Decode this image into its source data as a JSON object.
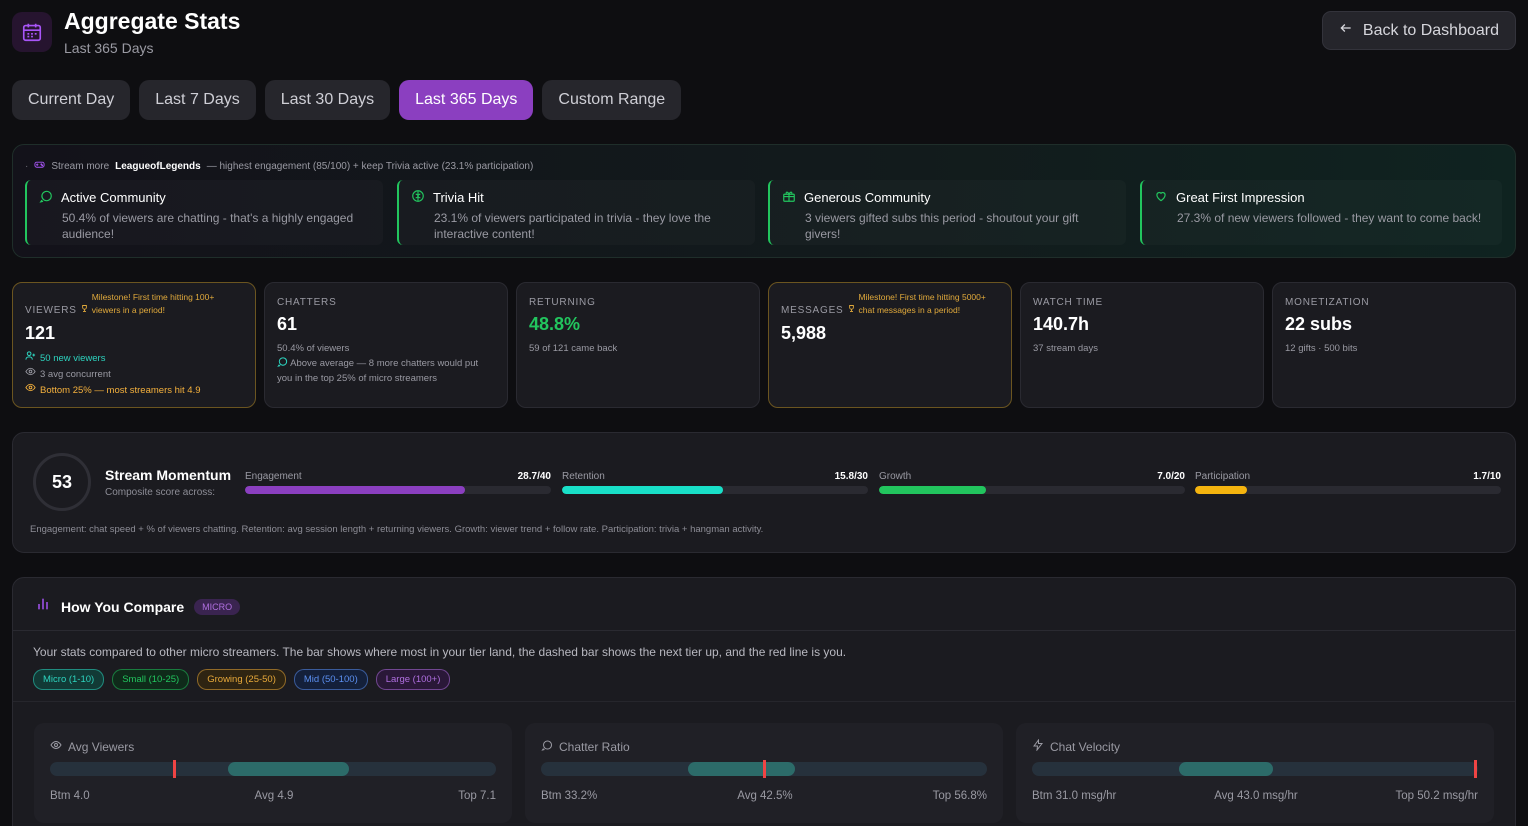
{
  "header": {
    "title": "Aggregate Stats",
    "subtitle": "Last 365 Days",
    "back_label": "Back to Dashboard"
  },
  "tabs": [
    {
      "label": "Current Day",
      "active": false
    },
    {
      "label": "Last 7 Days",
      "active": false
    },
    {
      "label": "Last 30 Days",
      "active": false
    },
    {
      "label": "Last 365 Days",
      "active": true
    },
    {
      "label": "Custom Range",
      "active": false
    }
  ],
  "insights": {
    "tip_prefix": "Stream more",
    "tip_game": "LeagueofLegends",
    "tip_suffix": "— highest engagement (85/100) + keep Trivia active (23.1% participation)",
    "cards": [
      {
        "title": "Active Community",
        "desc": "50.4% of viewers are chatting - that's a highly engaged audience!",
        "icon": "chat-icon"
      },
      {
        "title": "Trivia Hit",
        "desc": "23.1% of viewers participated in trivia - they love the interactive content!",
        "icon": "brain-icon"
      },
      {
        "title": "Generous Community",
        "desc": "3 viewers gifted subs this period - shoutout your gift givers!",
        "icon": "gift-icon"
      },
      {
        "title": "Great First Impression",
        "desc": "27.3% of new viewers followed - they want to come back!",
        "icon": "heart-icon"
      }
    ]
  },
  "stats": {
    "viewers": {
      "label": "VIEWERS",
      "milestone": "Milestone! First time hitting 100+ viewers in a period!",
      "value": "121",
      "new_viewers": "50 new viewers",
      "concurrent": "3 avg concurrent",
      "warning": "Bottom 25% — most streamers hit 4.9"
    },
    "chatters": {
      "label": "CHATTERS",
      "value": "61",
      "sub": "50.4% of viewers",
      "note": "Above average — 8 more chatters would put you in the top 25% of micro streamers"
    },
    "returning": {
      "label": "RETURNING",
      "value": "48.8%",
      "sub": "59 of 121 came back"
    },
    "messages": {
      "label": "MESSAGES",
      "milestone": "Milestone! First time hitting 5000+ chat messages in a period!",
      "value": "5,988"
    },
    "watch_time": {
      "label": "WATCH TIME",
      "value": "140.7h",
      "sub": "37 stream days"
    },
    "monetization": {
      "label": "MONETIZATION",
      "value": "22 subs",
      "sub": "12 gifts · 500 bits"
    }
  },
  "momentum": {
    "score": "53",
    "title": "Stream Momentum",
    "subtitle": "Composite score across:",
    "metrics": [
      {
        "label": "Engagement",
        "value_text": "28.7/40",
        "value": 28.7,
        "max": 40,
        "color": "#8b3fc0"
      },
      {
        "label": "Retention",
        "value_text": "15.8/30",
        "value": 15.8,
        "max": 30,
        "color": "#19e0c8"
      },
      {
        "label": "Growth",
        "value_text": "7.0/20",
        "value": 7.0,
        "max": 20,
        "color": "#22c55e"
      },
      {
        "label": "Participation",
        "value_text": "1.7/10",
        "value": 1.7,
        "max": 10,
        "color": "#f5b40f"
      }
    ],
    "note": "Engagement: chat speed + % of viewers chatting. Retention: avg session length + returning viewers. Growth: viewer trend + follow rate. Participation: trivia + hangman activity."
  },
  "compare": {
    "title": "How You Compare",
    "tier": "MICRO",
    "description": "Your stats compared to other micro streamers. The bar shows where most in your tier land, the dashed bar shows the next tier up, and the red line is you.",
    "chips": [
      {
        "label": "Micro (1-10)",
        "color": "#2dd4bf",
        "bg": "#123a36"
      },
      {
        "label": "Small (10-25)",
        "color": "#22c55e",
        "bg": "#0f2a1a"
      },
      {
        "label": "Growing (25-50)",
        "color": "#e8a93a",
        "bg": "#2e2412"
      },
      {
        "label": "Mid (50-100)",
        "color": "#5b8ff0",
        "bg": "#14203a"
      },
      {
        "label": "Large (100+)",
        "color": "#b06fe0",
        "bg": "#2a1838"
      }
    ],
    "cards": [
      {
        "title": "Avg Viewers",
        "icon": "eye-icon",
        "btm": "Btm 4.0",
        "avg": "Avg 4.9",
        "top": "Top 7.1",
        "band_start": 0.4,
        "band_end": 0.67,
        "you": 0.28
      },
      {
        "title": "Chatter Ratio",
        "icon": "chat-icon",
        "btm": "Btm 33.2%",
        "avg": "Avg 42.5%",
        "top": "Top 56.8%",
        "band_start": 0.33,
        "band_end": 0.57,
        "you": 0.5
      },
      {
        "title": "Chat Velocity",
        "icon": "bolt-icon",
        "btm": "Btm 31.0 msg/hr",
        "avg": "Avg 43.0 msg/hr",
        "top": "Top 50.2 msg/hr",
        "band_start": 0.33,
        "band_end": 0.54,
        "you": 0.995
      }
    ]
  }
}
